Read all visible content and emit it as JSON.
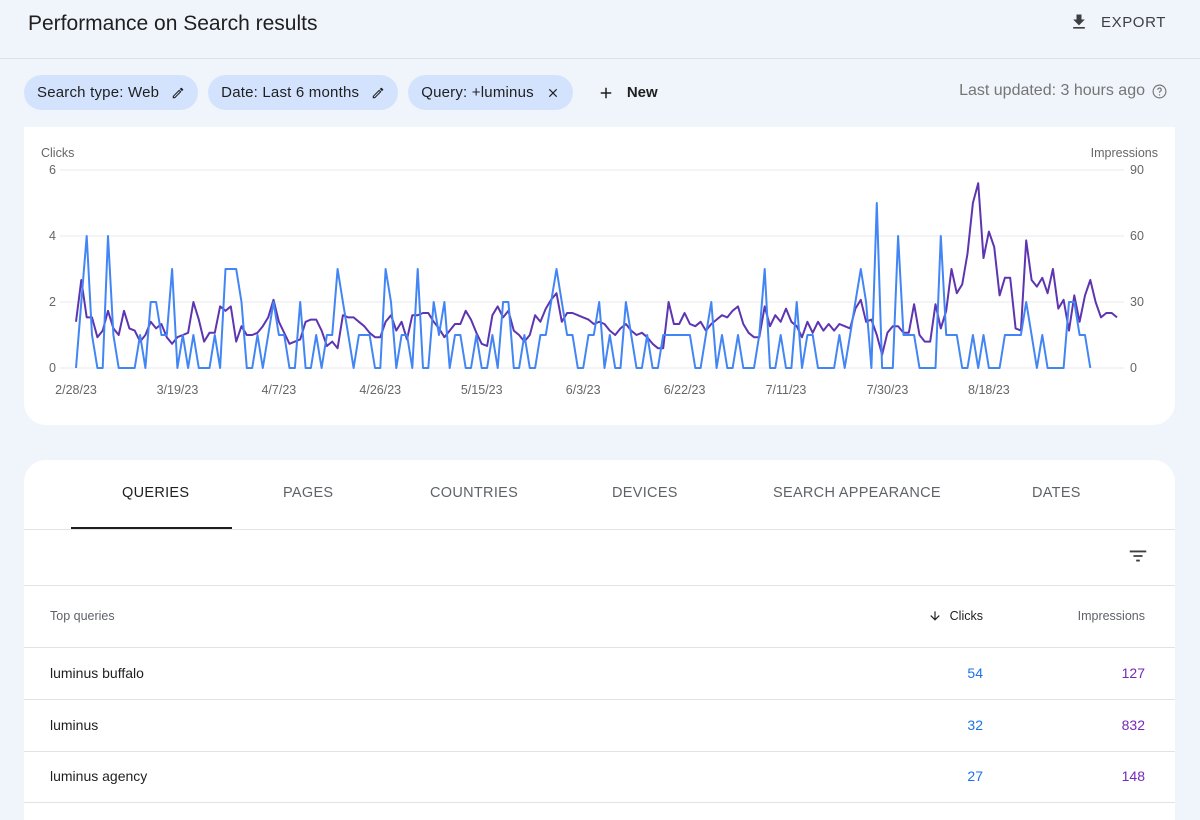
{
  "header": {
    "title": "Performance on Search results",
    "export_label": "EXPORT"
  },
  "filters": {
    "chips": [
      {
        "label": "Search type: Web",
        "action_icon": "pencil-icon"
      },
      {
        "label": "Date: Last 6 months",
        "action_icon": "pencil-icon"
      },
      {
        "label": "Query: +luminus",
        "action_icon": "close-icon"
      }
    ],
    "new_label": "New",
    "last_updated": "Last updated: 3 hours ago"
  },
  "colors": {
    "clicks": "#4285f4",
    "impressions": "#5e35b1",
    "clicks_text": "#1a73e8",
    "impressions_text": "#7627bb"
  },
  "chart_data": {
    "type": "line",
    "title": "",
    "left_axis": {
      "label": "Clicks",
      "ticks": [
        "0",
        "2",
        "4",
        "6"
      ],
      "range": [
        0,
        6
      ]
    },
    "right_axis": {
      "label": "Impressions",
      "ticks": [
        "0",
        "30",
        "60",
        "90"
      ],
      "range": [
        0,
        90
      ]
    },
    "x_tick_labels": [
      "2/28/23",
      "3/19/23",
      "4/7/23",
      "4/26/23",
      "5/15/23",
      "6/3/23",
      "6/22/23",
      "7/11/23",
      "7/30/23",
      "8/18/23"
    ],
    "x_tick_day_index": [
      0,
      19,
      38,
      57,
      76,
      95,
      114,
      133,
      152,
      171
    ],
    "grid": true,
    "legend": "none",
    "series": [
      {
        "name": "Clicks",
        "axis": "left",
        "values": [
          0,
          2,
          4,
          1,
          0,
          0,
          4,
          1,
          0,
          0,
          0,
          0,
          1,
          0,
          2,
          2,
          1,
          1,
          3,
          0,
          1,
          0,
          1,
          0,
          0,
          0,
          1,
          0,
          3,
          3,
          3,
          2,
          0,
          0,
          1,
          0,
          1,
          2,
          1,
          1,
          0,
          0,
          2,
          0,
          0,
          1,
          0,
          1,
          1,
          3,
          2,
          1,
          0,
          1,
          1,
          1,
          0,
          0,
          3,
          2,
          0,
          1,
          1,
          0,
          3,
          0,
          0,
          2,
          1,
          2,
          0,
          1,
          1,
          0,
          0,
          1,
          0,
          0,
          1,
          0,
          2,
          2,
          0,
          0,
          1,
          0,
          0,
          1,
          1,
          2,
          3,
          2,
          1,
          1,
          0,
          0,
          1,
          1,
          2,
          0,
          1,
          0,
          0,
          2,
          1,
          0,
          0,
          1,
          0,
          0,
          1,
          1,
          1,
          1,
          1,
          1,
          0,
          0,
          1,
          2,
          0,
          1,
          0,
          0,
          1,
          0,
          0,
          0,
          1,
          3,
          0,
          0,
          1,
          0,
          0,
          2,
          0,
          1,
          1,
          0,
          0,
          0,
          0,
          1,
          0,
          1,
          2,
          3,
          2,
          0,
          5,
          0,
          0,
          0,
          4,
          1,
          1,
          1,
          0,
          0,
          0,
          0,
          4,
          1,
          1,
          1,
          0,
          0,
          1,
          0,
          1,
          0,
          0,
          0,
          1,
          1,
          1,
          1,
          2,
          1,
          0,
          1,
          0,
          0,
          0,
          0,
          2,
          2,
          1,
          1,
          0
        ],
        "unit": "clicks/day"
      },
      {
        "name": "Impressions",
        "axis": "right",
        "values": [
          21,
          40,
          23,
          23,
          14,
          17,
          26,
          18,
          15,
          26,
          18,
          17,
          12,
          15,
          21,
          18,
          20,
          14,
          11,
          14,
          15,
          16,
          30,
          22,
          12,
          16,
          16,
          28,
          26,
          28,
          12,
          19,
          15,
          15,
          16,
          19,
          23,
          31,
          21,
          16,
          11,
          12,
          13,
          21,
          22,
          22,
          17,
          10,
          12,
          9,
          24,
          23,
          23,
          21,
          19,
          16,
          14,
          14,
          21,
          24,
          17,
          21,
          13,
          24,
          24,
          25,
          25,
          21,
          18,
          14,
          17,
          20,
          20,
          26,
          22,
          16,
          11,
          10,
          24,
          28,
          23,
          26,
          17,
          15,
          12,
          15,
          24,
          21,
          27,
          31,
          34,
          21,
          25,
          25,
          24,
          23,
          22,
          20,
          21,
          20,
          17,
          15,
          18,
          20,
          17,
          15,
          16,
          14,
          11,
          9,
          9,
          30,
          20,
          20,
          25,
          20,
          19,
          21,
          17,
          20,
          22,
          24,
          23,
          26,
          28,
          20,
          16,
          14,
          14,
          28,
          19,
          24,
          21,
          27,
          21,
          19,
          14,
          21,
          16,
          21,
          17,
          20,
          17,
          20,
          19,
          18,
          27,
          31,
          21,
          22,
          15,
          6,
          16,
          19,
          19,
          16,
          16,
          29,
          15,
          12,
          12,
          29,
          18,
          26,
          45,
          34,
          38,
          52,
          75,
          84,
          50,
          62,
          55,
          33,
          41,
          41,
          18,
          17,
          58,
          40,
          37,
          41,
          34,
          45,
          27,
          31,
          17,
          33,
          21,
          33,
          40,
          30,
          23,
          25,
          25,
          23
        ],
        "unit": "impressions/day"
      }
    ]
  },
  "tabs": [
    {
      "label": "QUERIES",
      "active": true
    },
    {
      "label": "PAGES",
      "active": false
    },
    {
      "label": "COUNTRIES",
      "active": false
    },
    {
      "label": "DEVICES",
      "active": false
    },
    {
      "label": "SEARCH APPEARANCE",
      "active": false
    },
    {
      "label": "DATES",
      "active": false
    }
  ],
  "table": {
    "columns": {
      "query": "Top queries",
      "clicks": "Clicks",
      "impressions": "Impressions",
      "sorted_by": "Clicks",
      "sort_direction": "descending"
    },
    "rows": [
      {
        "query": "luminus buffalo",
        "clicks": "54",
        "impressions": "127"
      },
      {
        "query": "luminus",
        "clicks": "32",
        "impressions": "832"
      },
      {
        "query": "luminus agency",
        "clicks": "27",
        "impressions": "148"
      }
    ]
  }
}
